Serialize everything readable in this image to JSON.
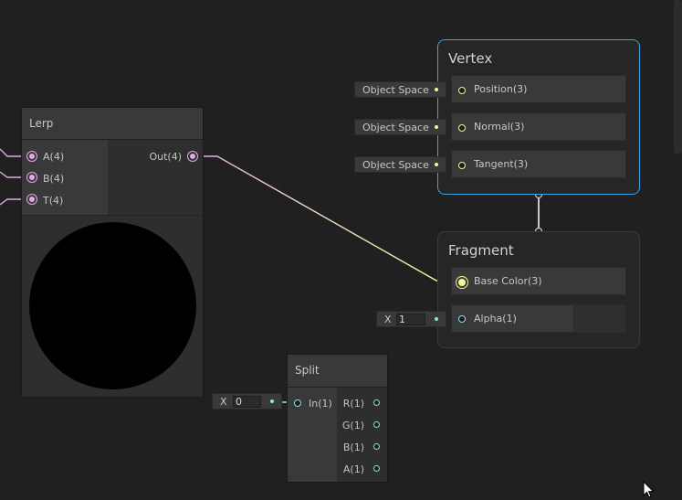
{
  "colors": {
    "canvas": "#202020",
    "node_body": "#2e2e2e",
    "node_header": "#393939",
    "vertex_border": "#3aa3e0",
    "fragment_border": "#3a3a3a",
    "vector4_port": "#e1a8e6",
    "vector3_port": "#f4f49a",
    "vector1_port": "#8ee2e8"
  },
  "lerp": {
    "title": "Lerp",
    "inputs": [
      "A(4)",
      "B(4)",
      "T(4)"
    ],
    "output": "Out(4)"
  },
  "vertex": {
    "title": "Vertex",
    "slots": [
      {
        "label": "Position(3)",
        "space": "Object Space"
      },
      {
        "label": "Normal(3)",
        "space": "Object Space"
      },
      {
        "label": "Tangent(3)",
        "space": "Object Space"
      }
    ]
  },
  "fragment": {
    "title": "Fragment",
    "base_color": "Base Color(3)",
    "alpha": "Alpha(1)",
    "alpha_input": {
      "axis": "X",
      "value": "1"
    }
  },
  "split": {
    "title": "Split",
    "input": "In(1)",
    "outputs": [
      "R(1)",
      "G(1)",
      "B(1)",
      "A(1)"
    ],
    "input_field": {
      "axis": "X",
      "value": "0"
    }
  }
}
